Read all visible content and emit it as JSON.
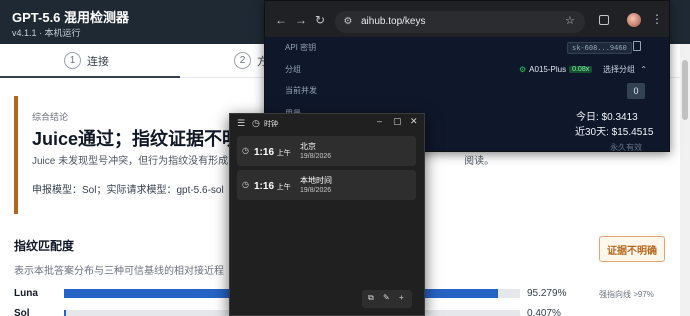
{
  "app": {
    "title": "GPT-5.6 混用检测器",
    "subtitle": "v4.1.1 · 本机运行",
    "steps": [
      {
        "num": "1",
        "label": "连接"
      },
      {
        "num": "2",
        "label": "方"
      }
    ]
  },
  "verdict": {
    "eyebrow": "综合结论",
    "headline": "Juice通过；指纹证据不明",
    "description": "Juice 未发现型号冲突，但行为指纹没有形成",
    "description_tail": "阅读。",
    "model_line": "申报模型：Sol；实际请求模型：gpt-5.6-sol"
  },
  "fingerprint": {
    "title": "指纹匹配度",
    "description": "表示本批答案分布与三种可信基线的相对接近程",
    "badge": "证据不明确",
    "rows": [
      {
        "label": "Luna",
        "value": "95.279%",
        "fraction": 0.95279,
        "note": "强指向线 >97%"
      },
      {
        "label": "Sol",
        "value": "0.407%",
        "fraction": 0.00407
      }
    ]
  },
  "browser": {
    "url": "aihub.top/keys",
    "api_key_label": "API 密钥",
    "api_key_value": "sk-608...9460",
    "group_label": "分组",
    "group_name": "A015-Plus",
    "group_ratio": "0.08x",
    "group_select": "选择分组",
    "concurrency_label": "当前并发",
    "concurrency_value": "0",
    "usage_label": "用量",
    "today": "今日: $0.3413",
    "last30": "近30天: $15.4515",
    "validity": "永久有效"
  },
  "clock": {
    "title": "时钟",
    "zones": [
      {
        "time": "1:16",
        "ampm": "上午",
        "name": "北京",
        "date": "19/8/2026"
      },
      {
        "time": "1:16",
        "ampm": "上午",
        "name": "本地时间",
        "date": "19/8/2026"
      }
    ]
  }
}
